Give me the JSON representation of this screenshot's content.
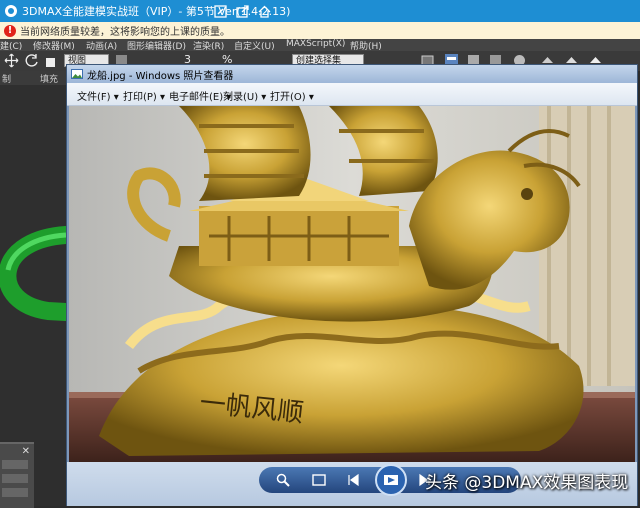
{
  "app": {
    "title": "3DMAX全能建模实战班（VIP）- 第5节 Ver(1.4.2.13)"
  },
  "warning": {
    "text": "当前网络质量较差，这将影响您的上课的质量。"
  },
  "max_menu": {
    "items": [
      "建(C)",
      "修改器(M)",
      "动画(A)",
      "图形编辑器(D)",
      "渲染(R)",
      "自定义(U)",
      "MAXScript(X)",
      "帮助(H)"
    ]
  },
  "max_toolbar": {
    "view_combo": "视图",
    "number": "3",
    "percent": "%",
    "selection_combo": "创建选择集"
  },
  "left_panel": {
    "tab_1": "制",
    "tab_2": "填充"
  },
  "viewer": {
    "title": "龙船.jpg - Windows 照片查看器",
    "menu": [
      "文件(F)",
      "打印(P)",
      "电子邮件(E)",
      "刻录(U)",
      "打开(O)"
    ],
    "photo_text": "一帆风顺"
  },
  "watermark": {
    "text": "头条 @3DMAX效果图表现"
  },
  "colors": {
    "title_bar": "#1e8ed3",
    "warning_bg": "#fdf3d6",
    "gold": "#c9a235",
    "viewer_frame": "#7f98b9"
  },
  "icons": {
    "warning": "error-icon",
    "edit": "edit-icon",
    "share": "share-icon",
    "home": "home-icon",
    "zoom": "zoom-icon",
    "fit": "actual-size-icon",
    "prev": "previous-icon",
    "slideshow": "slideshow-icon",
    "next": "next-icon"
  }
}
